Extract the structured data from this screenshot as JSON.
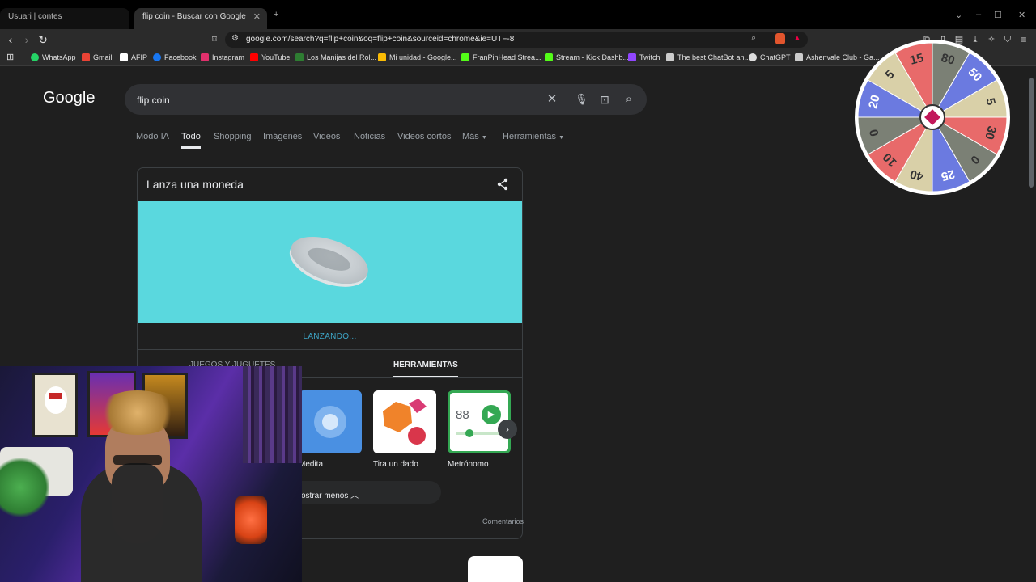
{
  "browser": {
    "tabs": [
      {
        "title": "Usuari | contes"
      },
      {
        "title": "flip coin - Buscar con Google"
      }
    ],
    "url": "google.com/search?q=flip+coin&oq=flip+coin&sourceid=chrome&ie=UTF-8",
    "bookmarks": [
      {
        "label": "WhatsApp",
        "color": "#25d366"
      },
      {
        "label": "Gmail",
        "color": "#ea4335"
      },
      {
        "label": "AFIP",
        "color": "#ffffff"
      },
      {
        "label": "Facebook",
        "color": "#1877f2"
      },
      {
        "label": "Instagram",
        "color": "#e1306c"
      },
      {
        "label": "YouTube",
        "color": "#ff0000"
      },
      {
        "label": "Los Manijas del Rol...",
        "color": "#2e7d32"
      },
      {
        "label": "Mi unidad - Google...",
        "color": "#fbbc04"
      },
      {
        "label": "FranPinHead Strea...",
        "color": "#53fc18"
      },
      {
        "label": "Stream - Kick Dashb...",
        "color": "#53fc18"
      },
      {
        "label": "Twitch",
        "color": "#9146ff"
      },
      {
        "label": "The best ChatBot an...",
        "color": "#cccccc"
      },
      {
        "label": "ChatGPT",
        "color": "#dddddd"
      },
      {
        "label": "Ashenvale Club - Ga...",
        "color": "#cccccc"
      }
    ]
  },
  "search": {
    "logo": "Google",
    "query": "flip coin",
    "tabs": [
      "Modo IA",
      "Todo",
      "Shopping",
      "Imágenes",
      "Videos",
      "Noticias",
      "Videos cortos",
      "Más",
      "Herramientas"
    ]
  },
  "card": {
    "title": "Lanza una moneda",
    "status": "LANZANDO...",
    "categories": [
      "JUEGOS Y JUGUETES",
      "HERRAMIENTAS"
    ],
    "tools": [
      {
        "label": "Medita",
        "color": "#4a90e2"
      },
      {
        "label": "Tira un dado",
        "color": "#ffffff"
      },
      {
        "label": "Metrónomo",
        "color": "#34a853",
        "value": "88"
      }
    ],
    "show_less": "ostrar menos",
    "feedback": "Comentarios"
  },
  "wheel": {
    "segments": [
      "15",
      "80",
      "50",
      "5",
      "30",
      "0",
      "25",
      "40",
      "10",
      "0",
      "20",
      "5"
    ],
    "colors": [
      "#e86a6a",
      "#7b8075",
      "#6b7ae0",
      "#d9d0a8"
    ]
  }
}
